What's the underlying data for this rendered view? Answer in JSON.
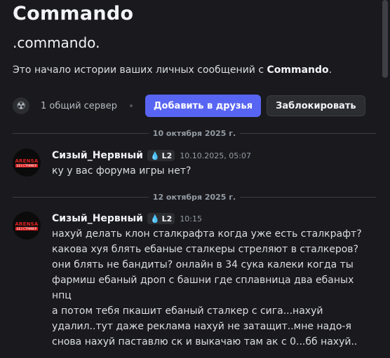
{
  "dm_header": {
    "title": "Commando",
    "username": ".commando.",
    "intro_prefix": "Это начало истории ваших личных сообщений с ",
    "intro_name": "Commando",
    "intro_suffix": "."
  },
  "mutual": {
    "server_icon": "radiation-icon",
    "label": "1 общий сервер",
    "add_friend_label": "Добавить в друзья",
    "block_label": "Заблокировать"
  },
  "colors": {
    "background": "#1a1a1e",
    "accent": "#5865f2",
    "tag_drop": "#4ea8e8"
  },
  "dividers": [
    "10 октября 2025 г.",
    "12 октября 2025 г."
  ],
  "messages": [
    {
      "author": "Сизый_Нервный",
      "tag": "L2",
      "time": "10.10.2025, 05:07",
      "avatar_text": [
        "ARENSA",
        "БЕЗ СТРИМЕР"
      ],
      "text": "ку у вас форума игры нет?"
    },
    {
      "author": "Сизый_Нервный",
      "tag": "L2",
      "time": "10:15",
      "avatar_text": [
        "ARENSA",
        "БЕЗ СТРИМЕР"
      ],
      "text": "нахуй делать клон сталкрафта когда уже есть сталкрафт?\nкакова хуя блять ебаные сталкеры стреляют в сталкеров?\nони блять не бандиты? онлайн в 34 сука калеки когда ты\nфармиш ебаный дроп с башни где сплавница два ебаных нпц\nа потом тебя пкашит ебаный сталкер с сига...нахуй\nудалил..тут даже реклама нахуй не затащит..мне надо-я\nснова нахуй паставлю ск и выкачаю там ак с 0...бб нахуй.."
    }
  ]
}
